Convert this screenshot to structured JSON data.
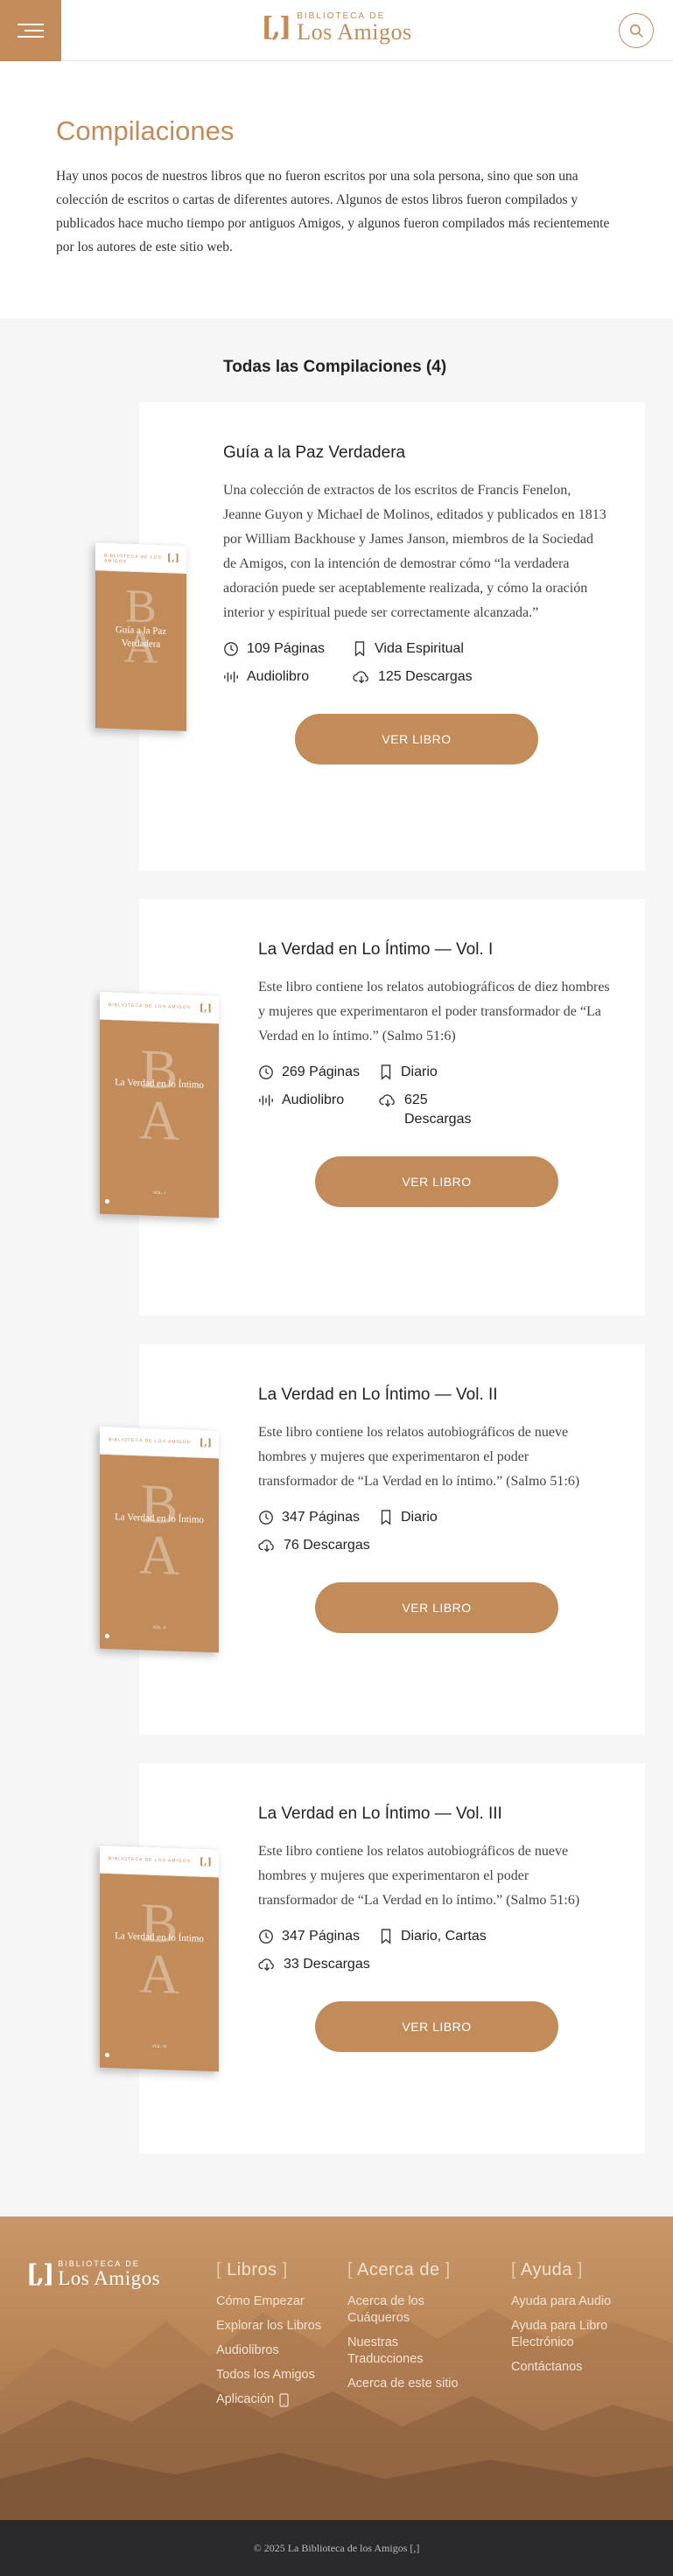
{
  "header": {
    "logo_mark": "[,]",
    "logo_top": "BIBLIOTECA DE",
    "logo_bottom": "Los Amigos",
    "menu_icon": "hamburger-icon",
    "search_icon": "search-icon"
  },
  "intro": {
    "title": "Compilaciones",
    "text": "Hay unos pocos de nuestros libros que no fueron escritos por una sola persona, sino que son una colección de escritos o cartas de diferentes autores. Algunos de estos libros fueron compilados y publicados hace mucho tiempo por antiguos Amigos, y algunos fueron compilados más recientemente por los autores de este sitio web."
  },
  "list": {
    "heading": "Todas las Compilaciones (4)",
    "books": [
      {
        "title": "Guía a la Paz Verdadera",
        "description": "Una colección de extractos de los escritos de Francis Fenelon, Jeanne Guyon y Michael de Molinos, editados y publicados en 1813 por William Backhouse y James Janson, miembros de la Sociedad de Amigos, con la intención de demostrar cómo “la verdadera adoración puede ser aceptablemente realizada, y cómo la oración interior y espiritual puede ser correctamente alcanzada.”",
        "pages": "109 Páginas",
        "category": "Vida Espiritual",
        "audio": "Audiolibro",
        "downloads": "125 Descargas",
        "button": "VER LIBRO",
        "cover_title": "Guía a la Paz Verdadera"
      },
      {
        "title": "La Verdad en Lo Íntimo — Vol. I",
        "description": "Este libro contiene los relatos autobiográficos de diez hombres y mujeres que experimentaron el poder transformador de “La Verdad en lo íntimo.” (Salmo 51:6)",
        "pages": "269 Páginas",
        "category": "Diario",
        "audio": "Audiolibro",
        "downloads": "625 Descargas",
        "button": "VER LIBRO",
        "cover_title": "La Verdad en lo Íntimo"
      },
      {
        "title": "La Verdad en Lo Íntimo — Vol. II",
        "description": "Este libro contiene los relatos autobiográficos de nueve hombres y mujeres que experimentaron el poder transformador de “La Verdad en lo íntimo.” (Salmo 51:6)",
        "pages": "347 Páginas",
        "category": "Diario",
        "downloads": "76 Descargas",
        "button": "VER LIBRO",
        "cover_title": "La Verdad en lo Íntimo"
      },
      {
        "title": "La Verdad en Lo Íntimo — Vol. III",
        "description": "Este libro contiene los relatos autobiográficos de nueve hombres y mujeres que experimentaron el poder transformador de “La Verdad en lo íntimo.” (Salmo 51:6)",
        "pages": "347 Páginas",
        "category": "Diario, Cartas",
        "downloads": "33 Descargas",
        "button": "VER LIBRO",
        "cover_title": "La Verdad en lo Íntimo"
      }
    ]
  },
  "footer": {
    "logo_mark": "[,]",
    "logo_top": "BIBLIOTECA DE",
    "logo_bottom": "Los Amigos",
    "columns": [
      {
        "title": "Libros",
        "links": [
          "Cómo Empezar",
          "Explorar los Libros",
          "Audiolibros",
          "Todos los Amigos",
          "Aplicación"
        ]
      },
      {
        "title": "Acerca de",
        "links": [
          "Acerca de los Cuáqueros",
          "Nuestras Traducciones",
          "Acerca de este sitio"
        ]
      },
      {
        "title": "Ayuda",
        "links": [
          "Ayuda para Audio",
          "Ayuda para Libro Electrónico",
          "Contáctanos"
        ]
      }
    ],
    "copyright": "© 2025 La Biblioteca de los Amigos [,]"
  },
  "colors": {
    "accent": "#c18c59",
    "section_bg": "#f6f6f6",
    "footer_dark": "#2a2a2e"
  }
}
